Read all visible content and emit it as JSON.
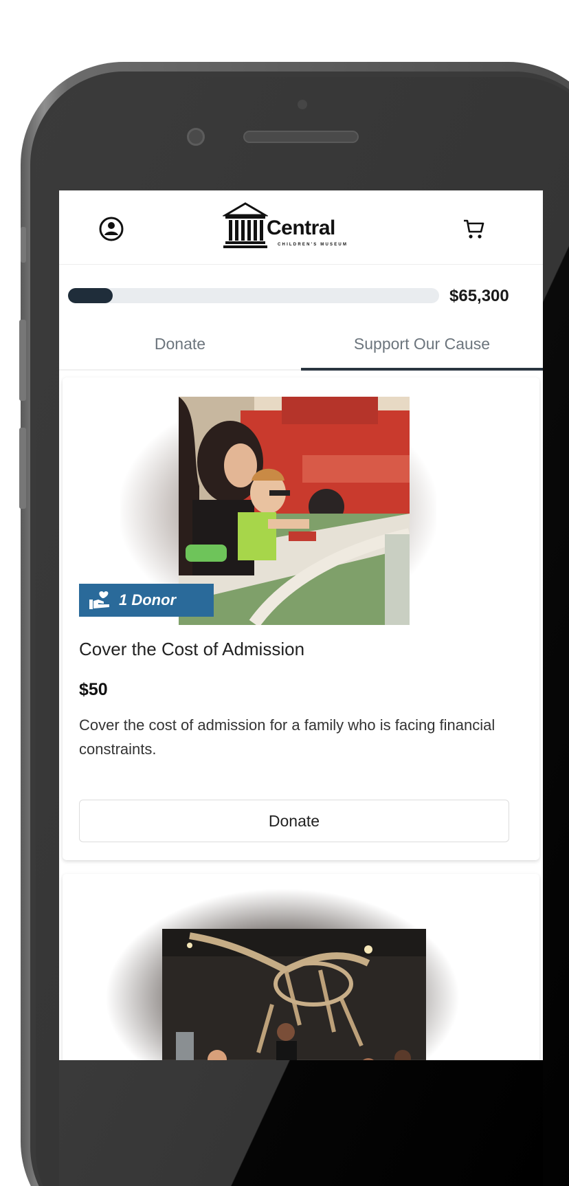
{
  "header": {
    "logo_name": "Central",
    "logo_subtitle": "CHILDREN'S MUSEUM"
  },
  "progress": {
    "fraction": 0.12,
    "amount": "$65,300"
  },
  "tabs": [
    {
      "label": "Donate",
      "active": false
    },
    {
      "label": "Support Our Cause",
      "active": true
    }
  ],
  "cards": [
    {
      "badge": "1 Donor",
      "title": "Cover the Cost of Admission",
      "price": "$50",
      "description": "Cover the cost of admission for a family who is facing financial constraints.",
      "button_label": "Donate"
    }
  ],
  "colors": {
    "accent_dark": "#1f2d3a",
    "badge_blue": "#2a6a9a"
  }
}
